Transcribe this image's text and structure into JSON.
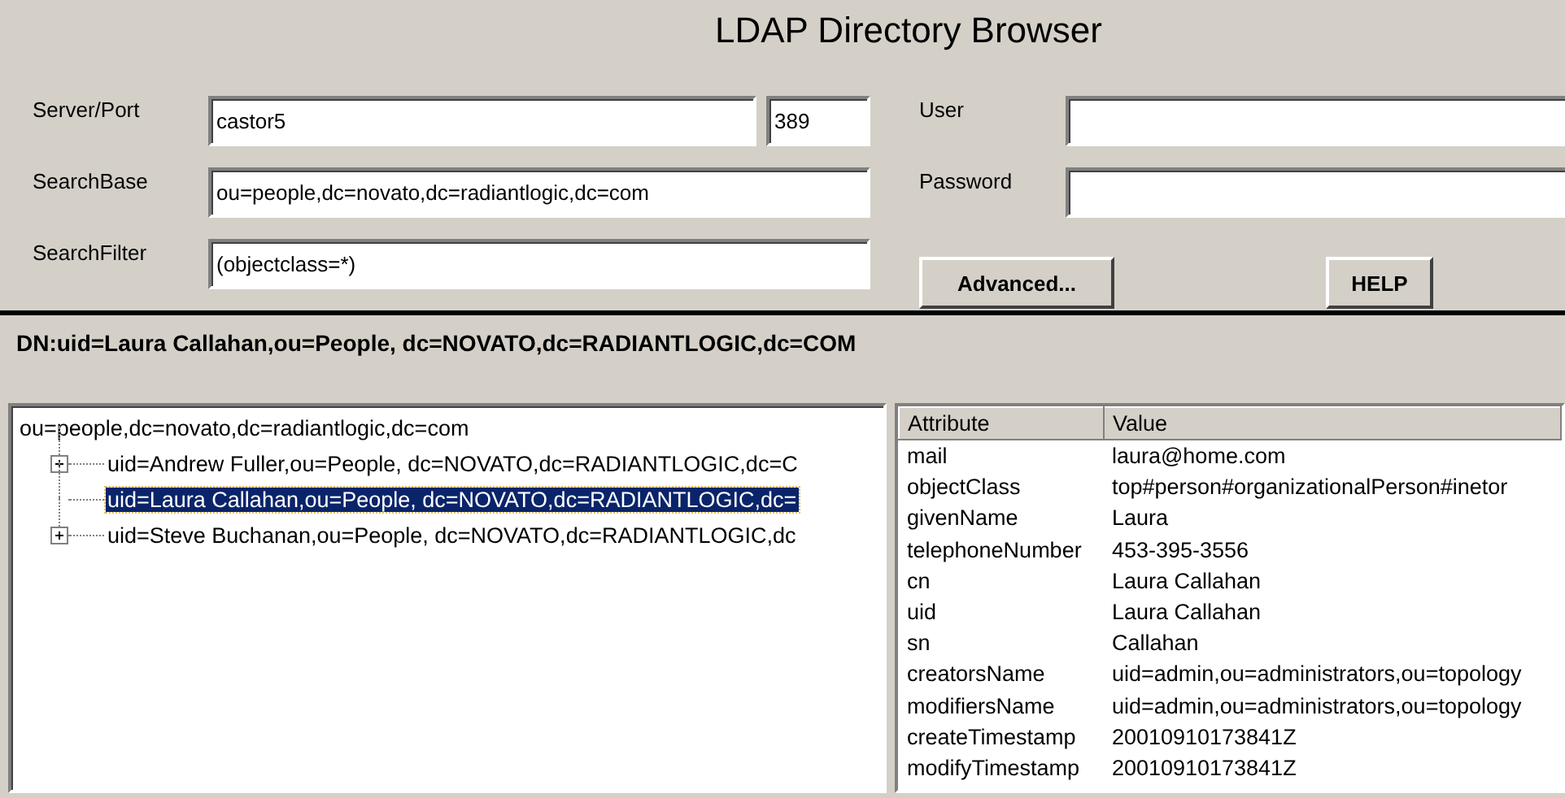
{
  "window": {
    "title": "LDAP Directory Browser"
  },
  "connection": {
    "server_label": "Server/Port",
    "server": "castor5",
    "port": "389",
    "search_base_label": "SearchBase",
    "search_base": "ou=people,dc=novato,dc=radiantlogic,dc=com",
    "search_filter_label": "SearchFilter",
    "search_filter": "(objectclass=*)",
    "user_label": "User",
    "password_label": "Password"
  },
  "buttons": [
    {
      "label": "Advanced..."
    },
    {
      "label": "HELP"
    }
  ],
  "dn": "DN:uid=Laura Callahan,ou=People, dc=NOVATO,dc=RADIANTLOGIC,dc=COM",
  "tree": {
    "label": "ou=people,dc=novato,dc=radiantlogic,dc=com",
    "children": [
      {
        "label": "uid=Andrew Fuller,ou=People, dc=NOVATO,dc=RADIANTLOGIC,dc=C",
        "expandable": true,
        "selected": false
      },
      {
        "label": "uid=Laura Callahan,ou=People, dc=NOVATO,dc=RADIANTLOGIC,dc=",
        "expandable": false,
        "selected": true
      },
      {
        "label": "uid=Steve Buchanan,ou=People, dc=NOVATO,dc=RADIANTLOGIC,dc",
        "expandable": true,
        "selected": false
      }
    ]
  },
  "table": {
    "columns": [
      "Attribute",
      "Value"
    ],
    "rows": [
      [
        "mail",
        "laura@home.com"
      ],
      [
        "objectClass",
        "top#person#organizationalPerson#inetor"
      ],
      [
        "givenName",
        "Laura"
      ],
      [
        "telephoneNumber",
        "453-395-3556"
      ],
      [
        "cn",
        "Laura Callahan"
      ],
      [
        "uid",
        "Laura Callahan"
      ],
      [
        "sn",
        "Callahan"
      ],
      [
        "creatorsName",
        "uid=admin,ou=administrators,ou=topology"
      ],
      [
        "modifiersName",
        "uid=admin,ou=administrators,ou=topology"
      ],
      [
        "createTimestamp",
        "20010910173841Z"
      ],
      [
        "modifyTimestamp",
        "20010910173841Z"
      ]
    ]
  }
}
